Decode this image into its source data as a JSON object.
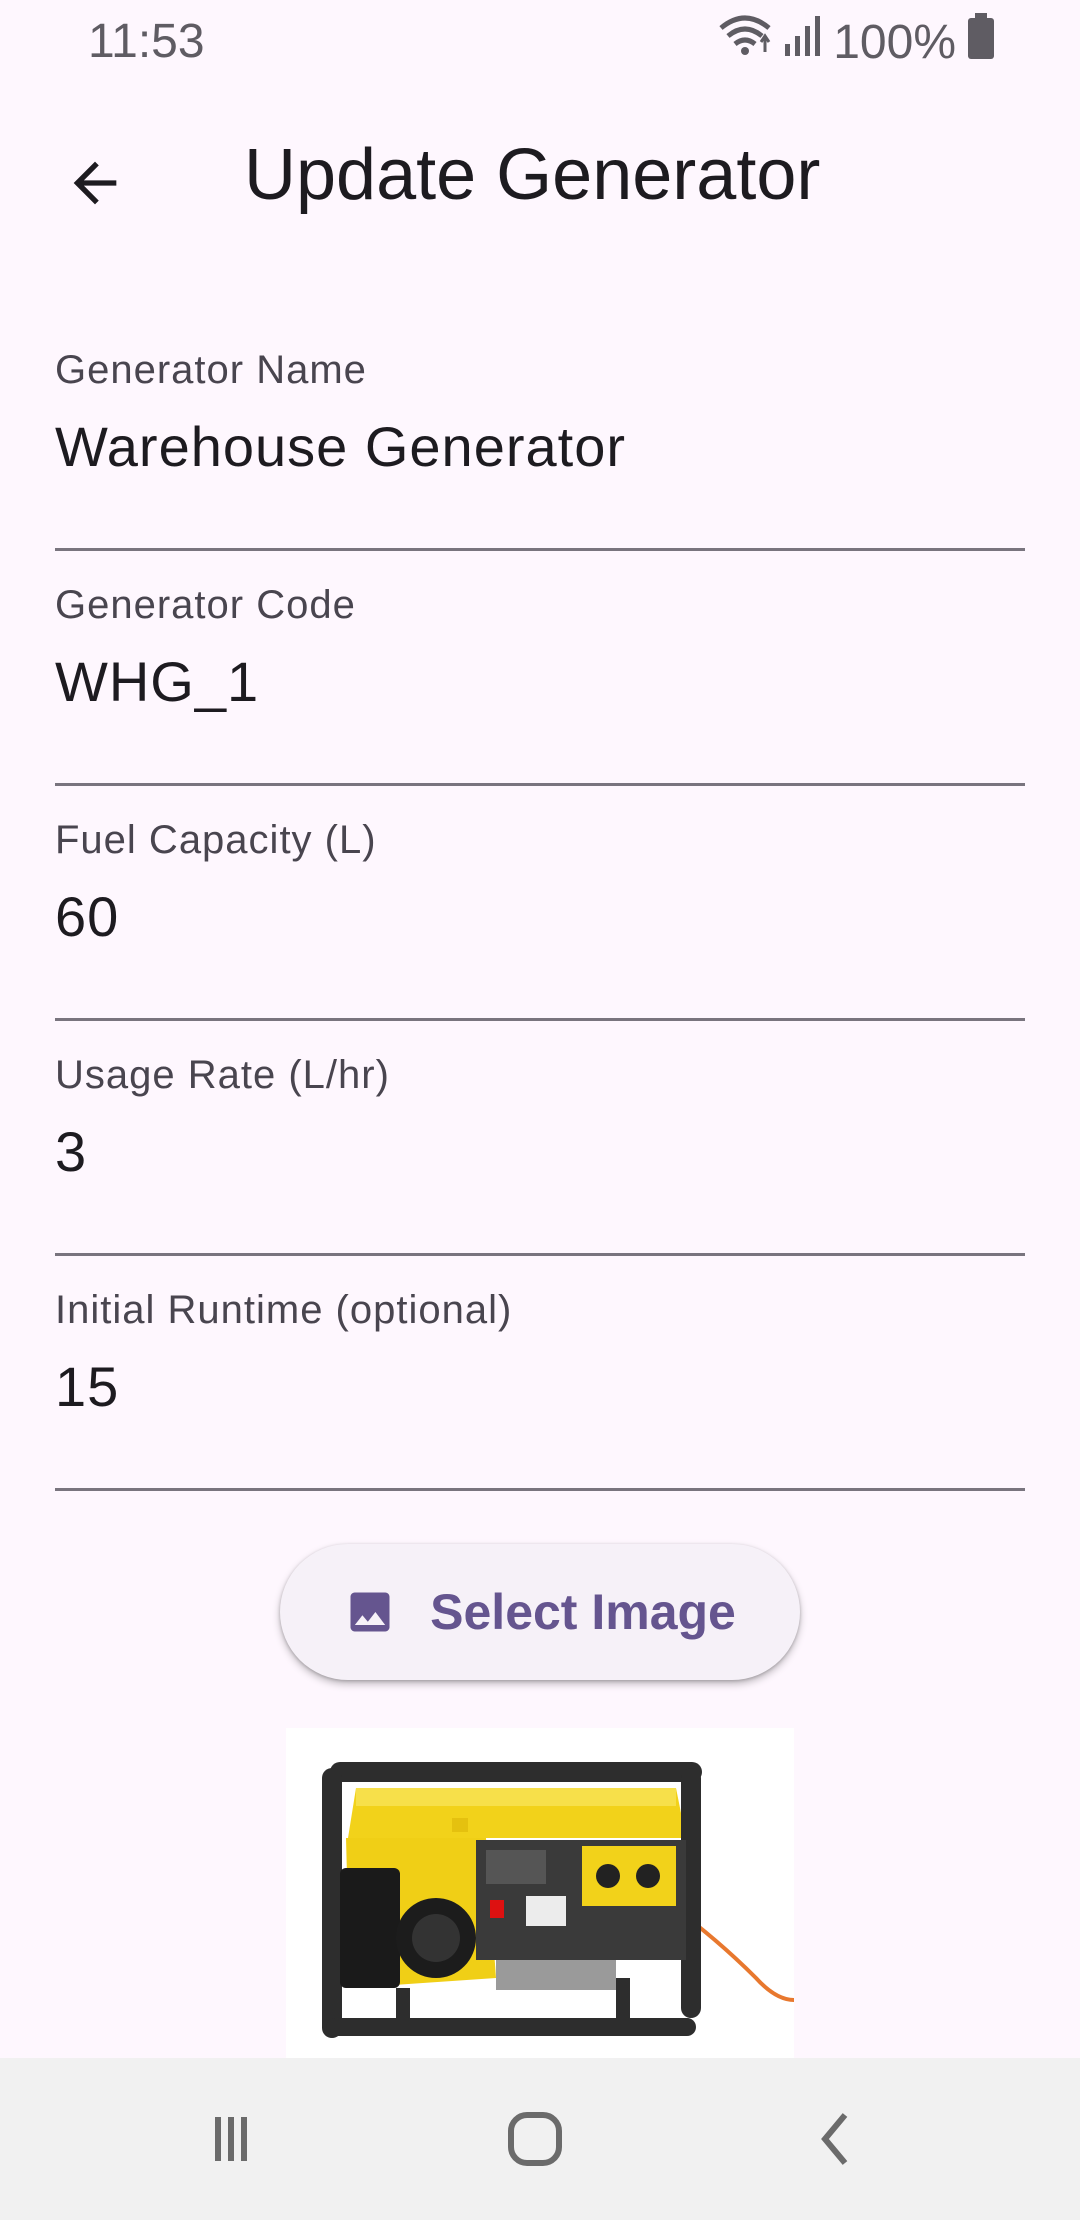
{
  "status_bar": {
    "time": "11:53",
    "battery_text": "100%",
    "icons": [
      "wifi-icon",
      "signal-icon",
      "battery-icon"
    ]
  },
  "app_bar": {
    "title": "Update Generator",
    "back_icon": "arrow-back-icon"
  },
  "form": {
    "fields": [
      {
        "label": "Generator Name",
        "value": "Warehouse Generator"
      },
      {
        "label": "Generator Code",
        "value": "WHG_1"
      },
      {
        "label": "Fuel Capacity (L)",
        "value": "60"
      },
      {
        "label": "Usage Rate (L/hr)",
        "value": "3"
      },
      {
        "label": "Initial Runtime (optional)",
        "value": "15"
      }
    ],
    "select_image": {
      "label": "Select Image",
      "icon": "image-icon"
    }
  },
  "colors": {
    "background": "#fef7fe",
    "accent": "#65558f",
    "text": "#1d1b20",
    "label": "#49454f",
    "underline": "#79747e"
  },
  "nav_bar": {
    "icons": [
      "recents-icon",
      "home-icon",
      "back-nav-icon"
    ]
  }
}
